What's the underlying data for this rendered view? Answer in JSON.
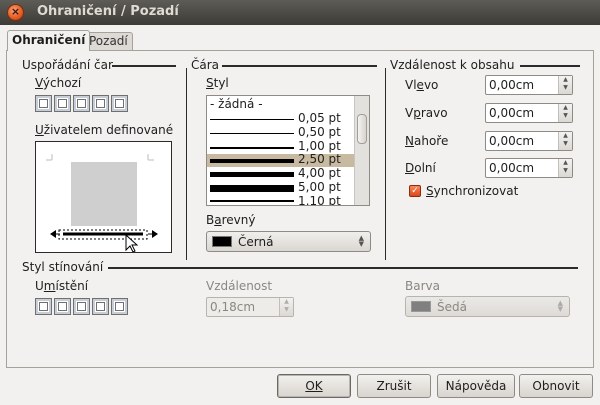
{
  "window": {
    "title": "Ohraničení / Pozadí",
    "close_glyph": "×"
  },
  "tabs": [
    {
      "label": "Ohraničení",
      "active": true
    },
    {
      "label": "Pozadí",
      "active": false
    }
  ],
  "line_arrangement": {
    "heading": "Uspořádání čar",
    "default_label": "Výchozí",
    "user_defined_label": "Uživatelem definované"
  },
  "line": {
    "heading": "Čára",
    "style_label": "Styl",
    "styles": [
      "- žádná -",
      "0,05 pt",
      "0,50 pt",
      "1,00 pt",
      "2,50 pt",
      "4,00 pt",
      "5,00 pt",
      "1,10 pt"
    ],
    "selected_style": "2,50 pt",
    "color_label": "Barevný",
    "color_value": "Černá",
    "color_hex": "#000000"
  },
  "spacing": {
    "heading": "Vzdálenost k obsahu",
    "left_label": "Vlevo",
    "left_value": "0,00cm",
    "right_label": "Vpravo",
    "right_value": "0,00cm",
    "top_label": "Nahoře",
    "top_value": "0,00cm",
    "bottom_label": "Dolní",
    "bottom_value": "0,00cm",
    "sync_label": "Synchronizovat",
    "sync_checked": true
  },
  "shadow": {
    "heading": "Styl stínování",
    "position_label": "Umístění",
    "distance_label": "Vzdálenost",
    "distance_value": "0,18cm",
    "color_label": "Barva",
    "color_value": "Šedá",
    "color_hex": "#808080"
  },
  "buttons": {
    "ok": "OK",
    "cancel": "Zrušit",
    "help": "Nápověda",
    "reset": "Obnovit"
  },
  "colors": {
    "accent": "#e45a20",
    "selection": "#c8b9a1"
  }
}
